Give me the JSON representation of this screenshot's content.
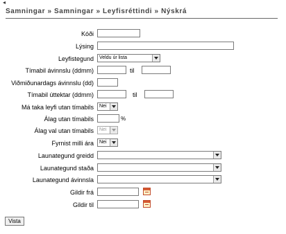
{
  "breadcrumb": {
    "back_icon": "back-arrow-icon",
    "text": "Samningar » Samningar » Leyfisréttindi » Nýskrá"
  },
  "form": {
    "kodi": {
      "label": "Kóði",
      "value": ""
    },
    "lysing": {
      "label": "Lýsing",
      "value": ""
    },
    "leyfistegund": {
      "label": "Leyfistegund",
      "selected": "Veldu úr lista"
    },
    "timabil_avinnslu": {
      "label": "Tímabil ávinnslu (ddmm)",
      "from": "",
      "separator": "til",
      "to": ""
    },
    "vidmidunardags": {
      "label": "Viðmiðunardags ávinnslu (dd)",
      "value": ""
    },
    "timabil_uttektar": {
      "label": "Tímabil úttektar (ddmm)",
      "from": "",
      "separator": "til",
      "to": ""
    },
    "ma_taka_leyfi": {
      "label": "Má taka leyfi utan tímabils",
      "selected": "Nei"
    },
    "alag_utan": {
      "label": "Álag utan tímabils",
      "value": "",
      "unit": "%"
    },
    "alag_val": {
      "label": "Álag val utan tímabils",
      "selected": "Nei",
      "disabled": true
    },
    "fyrnist": {
      "label": "Fyrnist milli ára",
      "selected": "Nei"
    },
    "launategund_greidd": {
      "label": "Launategund greidd",
      "selected": ""
    },
    "launategund_stada": {
      "label": "Launategund staða",
      "selected": ""
    },
    "launategund_avinnsla": {
      "label": "Launategund ávinnsla",
      "selected": ""
    },
    "gildir_fra": {
      "label": "Gildir frá",
      "value": "",
      "icon": "calendar-icon"
    },
    "gildir_til": {
      "label": "Gildir til",
      "value": "",
      "icon": "calendar-icon"
    }
  },
  "actions": {
    "submit_label": "Vista"
  }
}
